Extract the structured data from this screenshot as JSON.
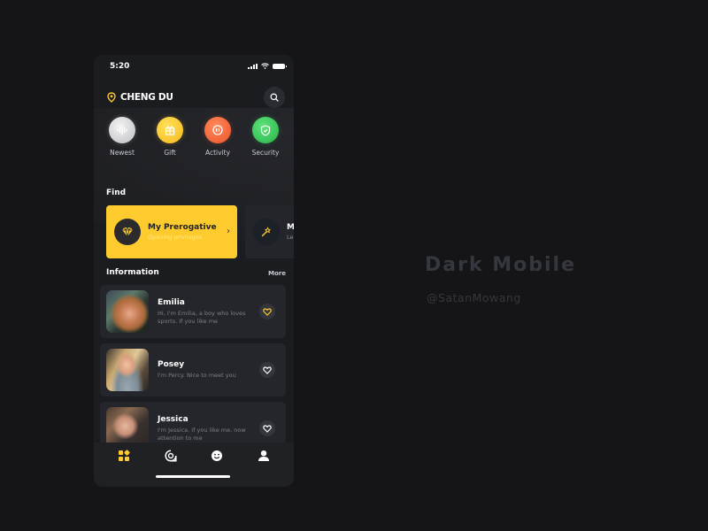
{
  "status_bar": {
    "time": "5:20"
  },
  "header": {
    "location": "CHENG DU",
    "search_icon": "search-icon",
    "location_icon": "location-pin-icon"
  },
  "quick_actions": [
    {
      "label": "Newest",
      "icon": "sound-wave-icon",
      "color": "#d9d9db"
    },
    {
      "label": "Gift",
      "icon": "gift-icon",
      "color": "#fdc82c"
    },
    {
      "label": "Activity",
      "icon": "pause-circle-icon",
      "color": "#f46a3e"
    },
    {
      "label": "Security",
      "icon": "shield-check-icon",
      "color": "#3ecb5e"
    }
  ],
  "find": {
    "title": "Find",
    "cards": [
      {
        "title": "My Prerogative",
        "subtitle": "Opening privileges",
        "icon": "diamond-icon"
      },
      {
        "title": "M",
        "subtitle": "Le",
        "icon": "magic-wand-icon"
      }
    ]
  },
  "information": {
    "title": "Information",
    "more_label": "More",
    "items": [
      {
        "name": "Emilia",
        "description": "Hi, I'm Emilia, a boy who loves sports. If you like me",
        "liked": true
      },
      {
        "name": "Posey",
        "description": "I'm Percy. Nice to meet you",
        "liked": false
      },
      {
        "name": "Jessica",
        "description": "I'm Jessica. If you like me, now attention to me",
        "liked": false
      }
    ]
  },
  "tab_bar": {
    "tabs": [
      {
        "name": "home",
        "icon": "grid-icon",
        "active": true
      },
      {
        "name": "messages",
        "icon": "chat-icon",
        "active": false
      },
      {
        "name": "moments",
        "icon": "smiley-icon",
        "active": false
      },
      {
        "name": "profile",
        "icon": "person-icon",
        "active": false
      }
    ]
  },
  "branding": {
    "title": "Dark Mobile",
    "author": "@SatanMowang"
  },
  "colors": {
    "accent": "#fecb2f",
    "background": "#151518",
    "surface": "#1b1c20",
    "card": "#24262b"
  }
}
